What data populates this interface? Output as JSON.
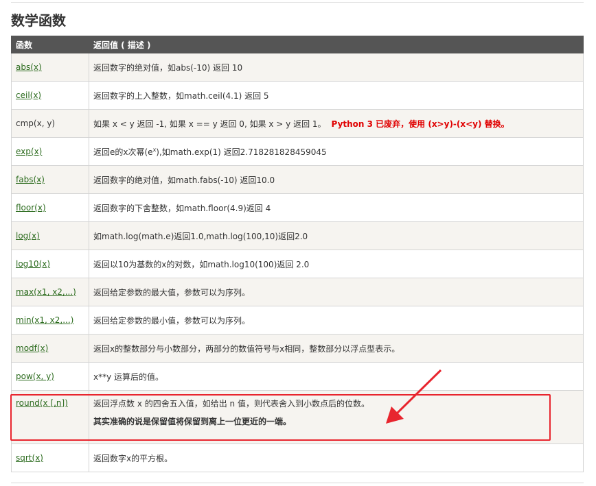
{
  "title": "数学函数",
  "table": {
    "headers": [
      "函数",
      "返回值 ( 描述 )"
    ],
    "rows": [
      {
        "fn": "abs(x)",
        "link": true,
        "desc": "返回数字的绝对值，如abs(-10) 返回 10"
      },
      {
        "fn": "ceil(x)",
        "link": true,
        "desc": "返回数字的上入整数，如math.ceil(4.1) 返回 5"
      },
      {
        "fn": "cmp(x, y)",
        "link": false,
        "desc": "如果 x < y 返回 -1, 如果 x == y 返回 0, 如果 x > y 返回 1。",
        "warn": "Python 3 已废弃，使用 (x>y)-(x<y) 替换。"
      },
      {
        "fn": "exp(x)",
        "link": true,
        "desc_pre": "返回e的x次幂(e",
        "desc_sup": "x",
        "desc_post": "),如math.exp(1) 返回2.718281828459045"
      },
      {
        "fn": "fabs(x)",
        "link": true,
        "desc": "返回数字的绝对值，如math.fabs(-10) 返回10.0"
      },
      {
        "fn": "floor(x)",
        "link": true,
        "desc": "返回数字的下舍整数，如math.floor(4.9)返回 4"
      },
      {
        "fn": "log(x)",
        "link": true,
        "desc": "如math.log(math.e)返回1.0,math.log(100,10)返回2.0"
      },
      {
        "fn": "log10(x)",
        "link": true,
        "desc": "返回以10为基数的x的对数，如math.log10(100)返回 2.0"
      },
      {
        "fn": "max(x1, x2,...)",
        "link": true,
        "desc": "返回给定参数的最大值，参数可以为序列。"
      },
      {
        "fn": "min(x1, x2,...)",
        "link": true,
        "desc": "返回给定参数的最小值，参数可以为序列。"
      },
      {
        "fn": "modf(x)",
        "link": true,
        "desc": "返回x的整数部分与小数部分，两部分的数值符号与x相同，整数部分以浮点型表示。"
      },
      {
        "fn": "pow(x, y)",
        "link": true,
        "desc": "x**y 运算后的值。"
      },
      {
        "fn": "round(x [,n])",
        "link": true,
        "desc": "返回浮点数 x 的四舍五入值，如给出 n 值，则代表舍入到小数点后的位数。",
        "note": "其实准确的说是保留值将保留到离上一位更近的一端。"
      },
      {
        "fn": "sqrt(x)",
        "link": true,
        "desc": "返回数字x的平方根。"
      }
    ]
  },
  "colors": {
    "header_bg": "#555555",
    "link": "#2a6a1c",
    "warn": "#e00000",
    "annotation": "#e8252e"
  }
}
